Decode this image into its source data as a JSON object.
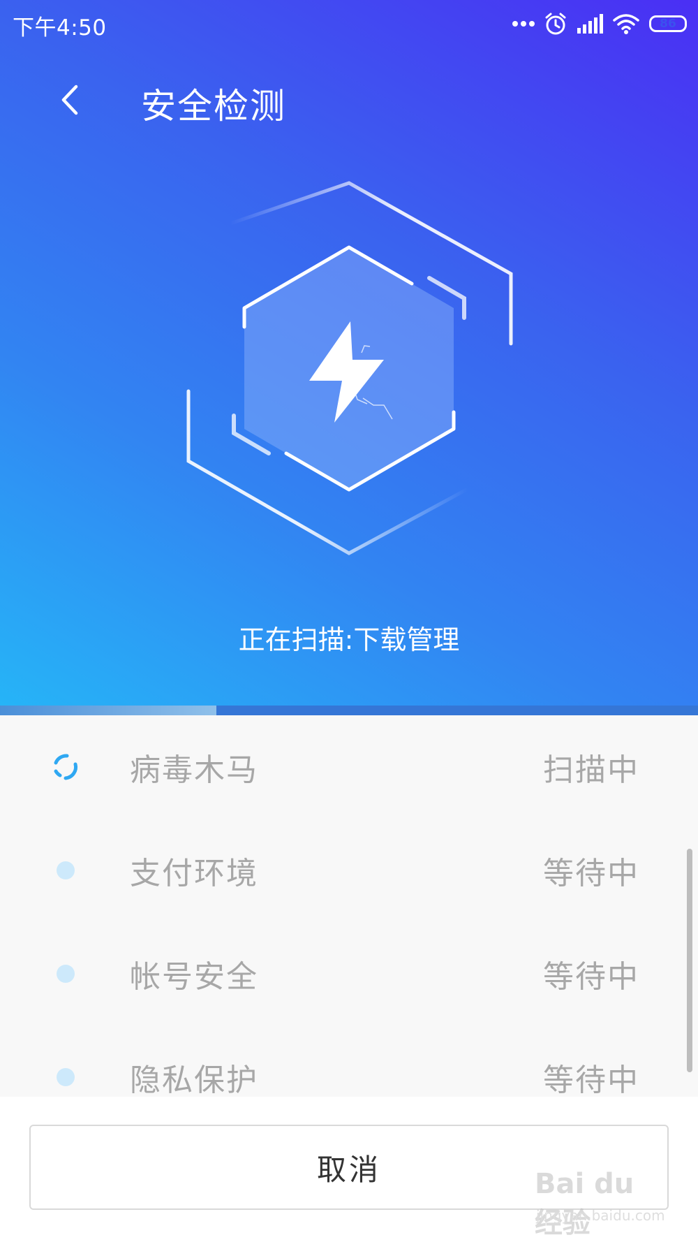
{
  "status_bar": {
    "time": "下午4:50",
    "battery_level": "86",
    "battery_fraction": 0.86,
    "icons": [
      "more-dots-icon",
      "alarm-clock-icon",
      "cellular-signal-icon",
      "wifi-icon",
      "battery-icon"
    ]
  },
  "header": {
    "back_icon": "chevron-left-icon",
    "title": "安全检测"
  },
  "hero": {
    "graphic_icon": "lightning-bolt-icon",
    "scan_status": "正在扫描:下载管理",
    "progress": 0.31,
    "colors": {
      "gradient_top_right": "#4a2ff4",
      "gradient_middle": "#3a63ef",
      "gradient_bottom_left": "#26b4f7"
    }
  },
  "scan_items": [
    {
      "label": "病毒木马",
      "status": "扫描中",
      "state": "scanning",
      "icon": "loading-spinner-icon"
    },
    {
      "label": "支付环境",
      "status": "等待中",
      "state": "waiting",
      "icon": "dot-icon"
    },
    {
      "label": "帐号安全",
      "status": "等待中",
      "state": "waiting",
      "icon": "dot-icon"
    },
    {
      "label": "隐私保护",
      "status": "等待中",
      "state": "waiting",
      "icon": "dot-icon"
    }
  ],
  "footer": {
    "cancel_label": "取消"
  },
  "watermark": {
    "logo": "Bai du 经验",
    "url": "jingyan.baidu.com"
  }
}
